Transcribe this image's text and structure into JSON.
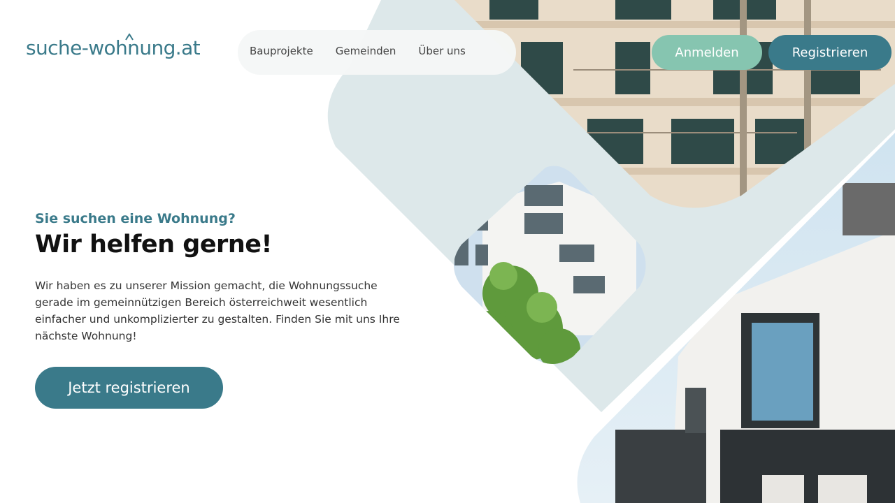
{
  "header": {
    "logo_text": "suche-wohnung.at",
    "nav": [
      "Bauprojekte",
      "Gemeinden",
      "Über uns"
    ],
    "login_label": "Anmelden",
    "register_label": "Registrieren"
  },
  "hero": {
    "kicker": "Sie suchen eine Wohnung?",
    "headline": "Wir helfen gerne!",
    "body": "Wir haben es zu unserer Mission gemacht, die Wohnungssuche gerade im gemeinnützigen Bereich österreichweit wesentlich einfacher und unkomplizierter zu gestalten. Finden Sie mit uns Ihre nächste Wohnung!",
    "cta_label": "Jetzt registrieren"
  },
  "colors": {
    "primary": "#3a7a8a",
    "secondary": "#86c5b0",
    "shape": "#dde8ea"
  },
  "images": [
    "balcony-building-photo",
    "white-apartment-tower-photo",
    "modern-house-photo"
  ]
}
